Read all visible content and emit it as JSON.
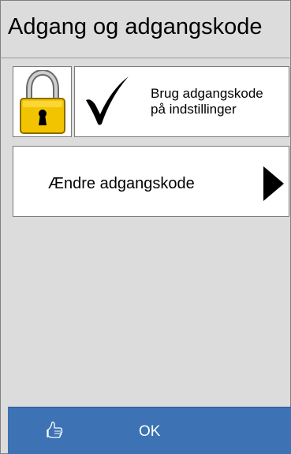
{
  "header": {
    "title": "Adgang og adgangskode"
  },
  "password_toggle": {
    "label_line1": "Brug adgangskode",
    "label_line2": "på indstillinger",
    "checked": true
  },
  "change_password": {
    "label": "Ændre adgangskode"
  },
  "footer": {
    "ok_label": "OK"
  },
  "icons": {
    "lock": "padlock-icon",
    "check": "checkmark-icon",
    "arrow": "arrow-right-icon",
    "ok": "thumbs-up-icon"
  },
  "colors": {
    "background": "#dcdcdc",
    "ok_bar": "#3d72b4",
    "lock_body": "#f2c400"
  }
}
